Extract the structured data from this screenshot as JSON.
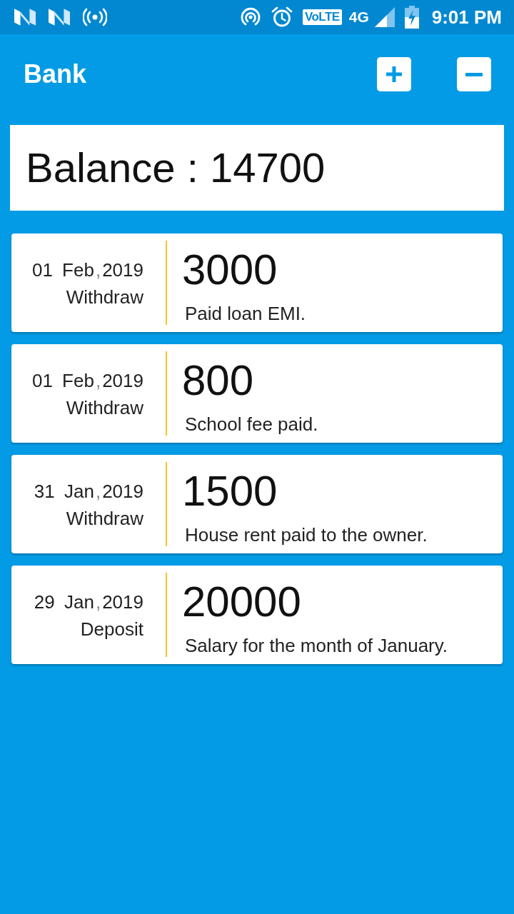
{
  "status_bar": {
    "volte": "VoLTE",
    "network": "4G",
    "time": "9:01 PM"
  },
  "app_bar": {
    "title": "Bank",
    "actions": [
      {
        "kind": "add"
      },
      {
        "kind": "remove"
      }
    ]
  },
  "balance": {
    "text": "Balance : 14700"
  },
  "transactions": [
    {
      "day": "01",
      "month": "Feb",
      "separator": ",",
      "year": "2019",
      "type": "Withdraw",
      "amount": "3000",
      "note": "Paid loan EMI."
    },
    {
      "day": "01",
      "month": "Feb",
      "separator": ",",
      "year": "2019",
      "type": "Withdraw",
      "amount": "800",
      "note": "School fee paid."
    },
    {
      "day": "31",
      "month": "Jan",
      "separator": ",",
      "year": "2019",
      "type": "Withdraw",
      "amount": "1500",
      "note": "House rent paid to the owner."
    },
    {
      "day": "29",
      "month": "Jan",
      "separator": ",",
      "year": "2019",
      "type": "Deposit",
      "amount": "20000",
      "note": "Salary for the month of January."
    }
  ]
}
